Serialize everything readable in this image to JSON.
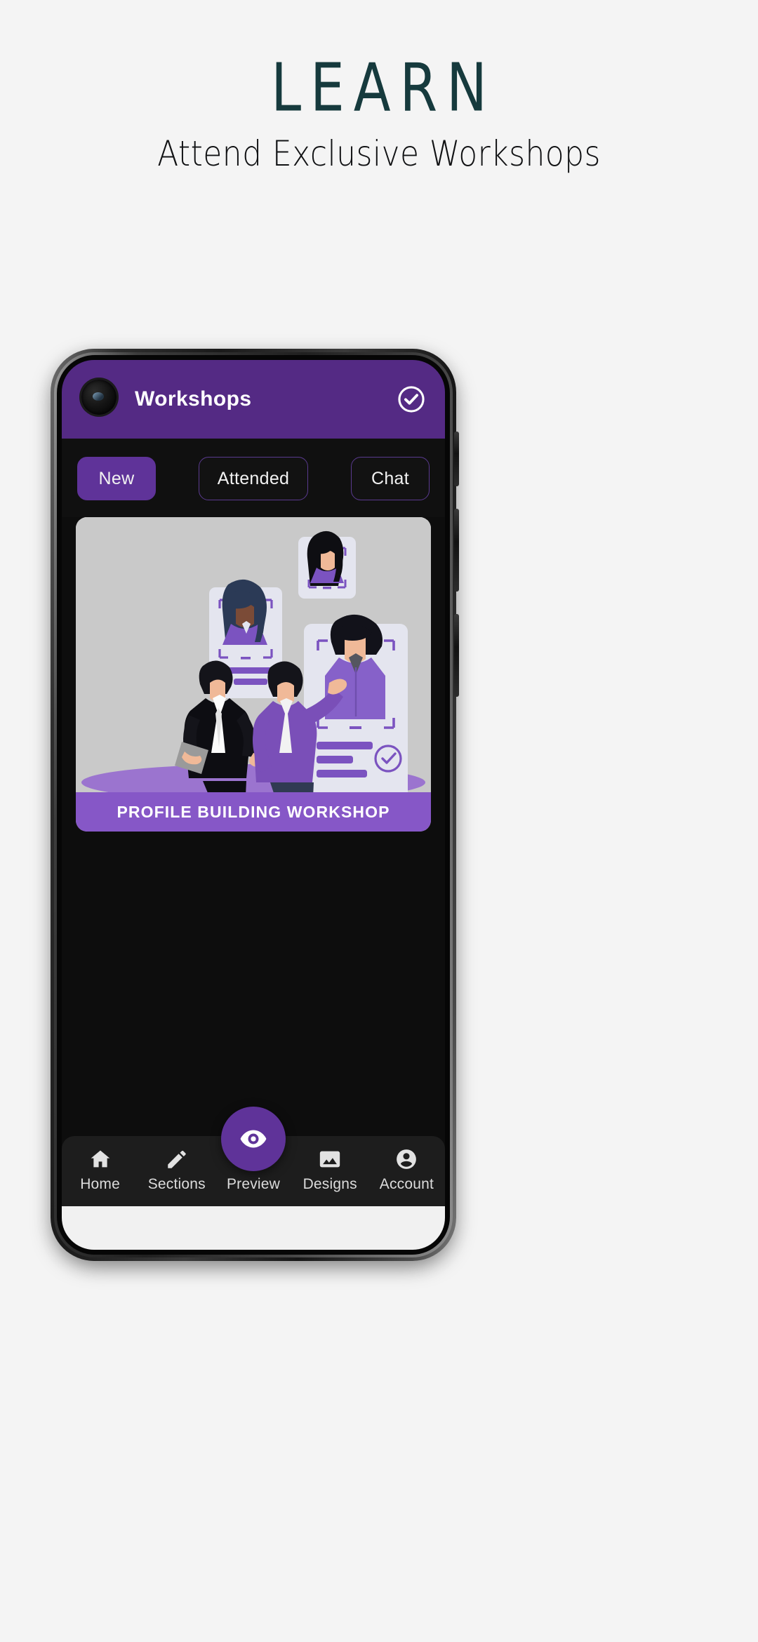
{
  "promo": {
    "title": "LEARN",
    "subtitle": "Attend Exclusive Workshops",
    "title_color": "#163a3d",
    "subtitle_color": "#111214",
    "background": "#f4f4f4"
  },
  "app": {
    "appbar": {
      "title": "Workshops",
      "background": "#542a84",
      "title_color": "#ffffff",
      "action_icon": "check-circle-icon",
      "camera_icon": "punch-hole-camera"
    },
    "filters": [
      {
        "label": "New",
        "active": true
      },
      {
        "label": "Attended",
        "active": false
      },
      {
        "label": "Chat",
        "active": false
      }
    ],
    "filter_active_color": "#5f3399",
    "filter_border_color": "#5a3a8f",
    "cards": [
      {
        "caption": "PROFILE BUILDING WORKSHOP",
        "caption_background": "#8657c7",
        "art_background": "#c9c9c9",
        "art_description": "two-businessmen-handshake-with-floating-profile-cards"
      }
    ],
    "screen_background": "#0d0d0d",
    "bottom_nav": {
      "background": "#1d1d1d",
      "fab": {
        "label": "Preview",
        "icon": "eye-icon",
        "color": "#5f3399"
      },
      "items": [
        {
          "label": "Home",
          "icon": "home-icon"
        },
        {
          "label": "Sections",
          "icon": "pencil-icon"
        },
        {
          "label": "Preview",
          "icon": "eye-icon"
        },
        {
          "label": "Designs",
          "icon": "image-icon"
        },
        {
          "label": "Account",
          "icon": "account-circle-icon"
        }
      ]
    }
  }
}
